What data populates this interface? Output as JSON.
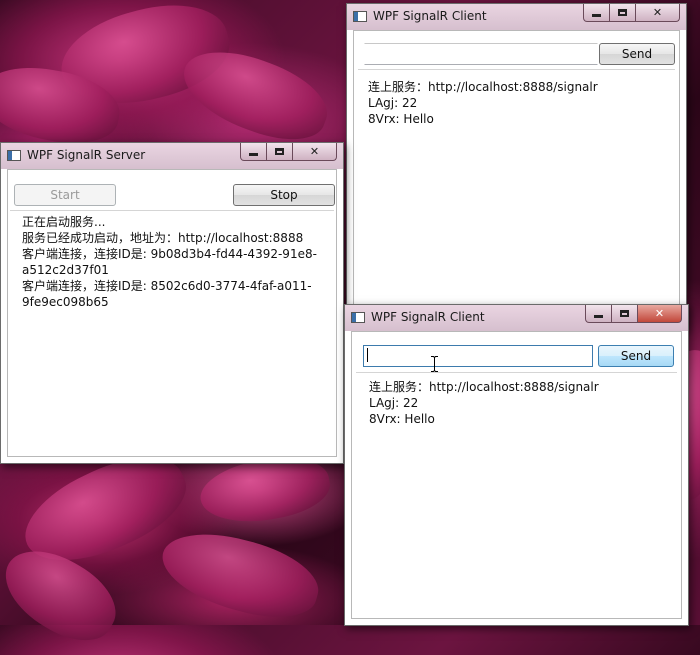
{
  "server": {
    "title": "WPF SignalR Server",
    "start_label": "Start",
    "stop_label": "Stop",
    "log": [
      "正在启动服务...",
      "服务已经成功启动，地址为：http://localhost:8888",
      "客户端连接，连接ID是: 9b08d3b4-fd44-4392-91e8-a512c2d37f01",
      "客户端连接，连接ID是: 8502c6d0-3774-4faf-a011-9fe9ec098b65"
    ]
  },
  "client1": {
    "title": "WPF SignalR Client",
    "input_value": "",
    "send_label": "Send",
    "log": [
      "连上服务：http://localhost:8888/signalr",
      "LAgj: 22",
      "8Vrx: Hello"
    ]
  },
  "client2": {
    "title": "WPF SignalR Client",
    "input_value": "",
    "send_label": "Send",
    "log": [
      "连上服务：http://localhost:8888/signalr",
      "LAgj: 22",
      "8Vrx: Hello"
    ]
  },
  "colors": {
    "desktop_primary": "#6c1440",
    "petal_highlight": "#e05597",
    "close_button": "#c2473a",
    "focus_border": "#3d7bad"
  },
  "icons": {
    "minimize": "minimize-icon",
    "maximize": "maximize-icon",
    "close": "close-icon",
    "app": "wpf-app-icon",
    "cursor": "ibeam-cursor-icon"
  }
}
